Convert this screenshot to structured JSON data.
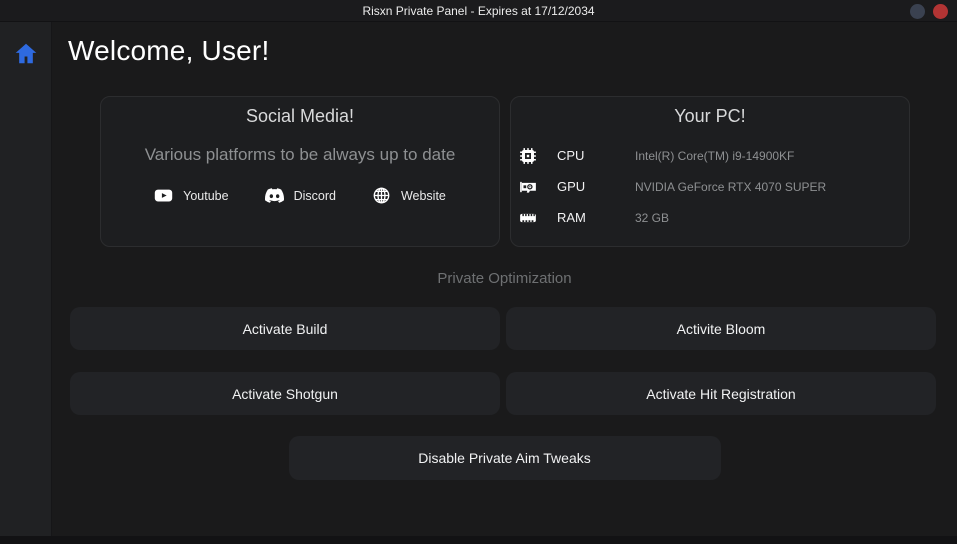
{
  "titlebar": {
    "title": "Risxn Private Panel - Expires at 17/12/2034",
    "minimize_icon": "minimize-circle",
    "close_icon": "close-circle"
  },
  "sidebar": {
    "home_icon": "home-icon"
  },
  "main": {
    "welcome": "Welcome, User!",
    "social_card": {
      "title": "Social Media!",
      "subtitle": "Various platforms to be always up to date",
      "links": [
        {
          "label": "Youtube",
          "icon": "youtube-icon"
        },
        {
          "label": "Discord",
          "icon": "discord-icon"
        },
        {
          "label": "Website",
          "icon": "globe-icon"
        }
      ]
    },
    "pc_card": {
      "title": "Your PC!",
      "rows": [
        {
          "label": "CPU",
          "value": "Intel(R) Core(TM) i9-14900KF",
          "icon": "cpu-icon"
        },
        {
          "label": "GPU",
          "value": "NVIDIA GeForce RTX 4070 SUPER",
          "icon": "gpu-icon"
        },
        {
          "label": "RAM",
          "value": "32 GB",
          "icon": "ram-icon"
        }
      ]
    },
    "section_label": "Private Optimization",
    "buttons": [
      {
        "label": "Activate Build"
      },
      {
        "label": "Activite Bloom"
      },
      {
        "label": "Activate Shotgun"
      },
      {
        "label": "Activate Hit Registration"
      },
      {
        "label": "Disable Private Aim Tweaks"
      }
    ]
  },
  "colors": {
    "accent_blue": "#2e6ae0",
    "close_red": "#b23434",
    "minimize_gray": "#3a4150",
    "background": "#1a1a1b",
    "sidebar": "#202123",
    "card": "#1d1e20",
    "button": "#222326"
  }
}
